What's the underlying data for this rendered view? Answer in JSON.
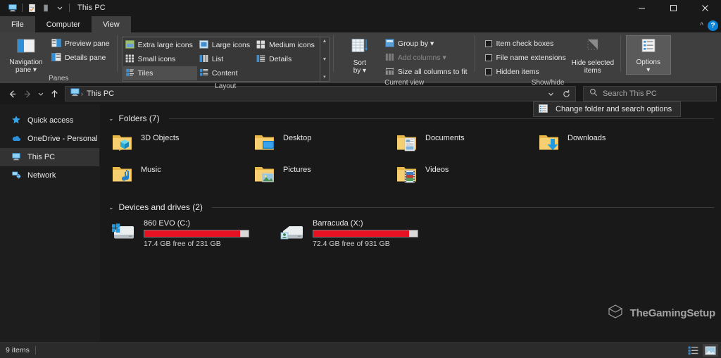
{
  "window": {
    "title": "This PC",
    "quick_access_icons": [
      "this-pc-icon",
      "properties-icon",
      "new-folder-icon",
      "customize-qat-chevron"
    ],
    "controls": {
      "minimize": "—",
      "maximize": "□",
      "close": "✕"
    },
    "ribbon_collapse": "^",
    "help": "?"
  },
  "tabs": [
    {
      "label": "File",
      "active": false
    },
    {
      "label": "Computer",
      "active": false
    },
    {
      "label": "View",
      "active": true
    }
  ],
  "ribbon": {
    "groups": [
      {
        "label": "Panes",
        "big_buttons": [
          {
            "label": "Navigation\npane",
            "line1": "Navigation",
            "line2": "pane ▾",
            "icon": "navigation-pane-icon"
          }
        ],
        "small_buttons": [
          {
            "label": "Preview pane",
            "icon": "preview-pane-icon",
            "disabled": false
          },
          {
            "label": "Details pane",
            "icon": "details-pane-icon",
            "disabled": false
          }
        ]
      },
      {
        "label": "Layout",
        "gallery": [
          {
            "label": "Extra large icons",
            "icon": "extra-large-icons-icon",
            "selected": false
          },
          {
            "label": "Large icons",
            "icon": "large-icons-icon",
            "selected": false
          },
          {
            "label": "Medium icons",
            "icon": "medium-icons-icon",
            "selected": false
          },
          {
            "label": "Small icons",
            "icon": "small-icons-icon",
            "selected": false
          },
          {
            "label": "List",
            "icon": "list-icon",
            "selected": false
          },
          {
            "label": "Details",
            "icon": "details-icon",
            "selected": false
          },
          {
            "label": "Tiles",
            "icon": "tiles-icon",
            "selected": true
          },
          {
            "label": "Content",
            "icon": "content-icon",
            "selected": false
          }
        ],
        "scroll_arrows": [
          "▲",
          "▼",
          "▾"
        ]
      },
      {
        "label": "Current view",
        "big_buttons": [
          {
            "line1": "Sort",
            "line2": "by ▾",
            "icon": "sort-by-icon"
          }
        ],
        "small_buttons": [
          {
            "label": "Group by ▾",
            "icon": "group-by-icon",
            "disabled": false
          },
          {
            "label": "Add columns ▾",
            "icon": "add-columns-icon",
            "disabled": true
          },
          {
            "label": "Size all columns to fit",
            "icon": "size-columns-icon",
            "disabled": false
          }
        ]
      },
      {
        "label": "Show/hide",
        "checkboxes": [
          {
            "label": "Item check boxes",
            "checked": false
          },
          {
            "label": "File name extensions",
            "checked": false
          },
          {
            "label": "Hidden items",
            "checked": false
          }
        ],
        "big_buttons": [
          {
            "line1": "Hide selected",
            "line2": "items",
            "icon": "hide-selected-items-icon"
          }
        ]
      },
      {
        "label": "",
        "big_buttons": [
          {
            "line1": "Options",
            "line2": "▾",
            "icon": "options-icon",
            "hovered": true
          }
        ]
      }
    ],
    "dropdown": {
      "label": "Change folder and search options",
      "underline_char": "o",
      "icon": "folder-options-icon"
    }
  },
  "address": {
    "back": "←",
    "forward": "→",
    "recent": "▾",
    "up": "↑",
    "breadcrumb_icon": "this-pc-icon",
    "breadcrumb": "This PC",
    "breadcrumb_sep": "›",
    "dropdown": "▾",
    "refresh": "↻",
    "search_placeholder": "Search This PC",
    "search_value": "",
    "search_icon": "search-icon"
  },
  "sidebar": {
    "items": [
      {
        "label": "Quick access",
        "icon": "star-icon",
        "selected": false
      },
      {
        "label": "OneDrive - Personal",
        "icon": "onedrive-cloud-icon",
        "selected": false
      },
      {
        "label": "This PC",
        "icon": "this-pc-icon",
        "selected": true
      },
      {
        "label": "Network",
        "icon": "network-icon",
        "selected": false
      }
    ]
  },
  "content": {
    "folders_group": {
      "label": "Folders (7)",
      "collapse_chevron": "⌄",
      "items": [
        {
          "name": "3D Objects",
          "icon": "folder-3d-objects-icon"
        },
        {
          "name": "Desktop",
          "icon": "folder-desktop-icon"
        },
        {
          "name": "Documents",
          "icon": "folder-documents-icon"
        },
        {
          "name": "Downloads",
          "icon": "folder-downloads-icon"
        },
        {
          "name": "Music",
          "icon": "folder-music-icon"
        },
        {
          "name": "Pictures",
          "icon": "folder-pictures-icon"
        },
        {
          "name": "Videos",
          "icon": "folder-videos-icon"
        }
      ]
    },
    "drives_group": {
      "label": "Devices and drives (2)",
      "collapse_chevron": "⌄",
      "items": [
        {
          "name": "860 EVO (C:)",
          "free_text": "17.4 GB free of 231 GB",
          "free_gb": 17.4,
          "total_gb": 231,
          "used_percent": 92,
          "bar_color": "#e81123",
          "icon": "windows-drive-icon"
        },
        {
          "name": "Barracuda (X:)",
          "free_text": "72.4 GB free of 931 GB",
          "free_gb": 72.4,
          "total_gb": 931,
          "used_percent": 92,
          "bar_color": "#e81123",
          "icon": "hard-drive-icon"
        }
      ]
    }
  },
  "statusbar": {
    "item_count": "9 items",
    "view_buttons": [
      {
        "name": "details-view-button",
        "selected": false
      },
      {
        "name": "large-icons-view-button",
        "selected": true
      }
    ]
  },
  "watermark": {
    "text": "TheGamingSetup",
    "icon": "cube-logo-icon"
  },
  "colors": {
    "accent_blue": "#0a84d8",
    "drive_bar_red": "#e81123",
    "ribbon_bg": "#3f3f3f",
    "window_bg": "#191919",
    "sidebar_bg": "#1d1d1d",
    "folder_yellow": "#f4c661"
  }
}
